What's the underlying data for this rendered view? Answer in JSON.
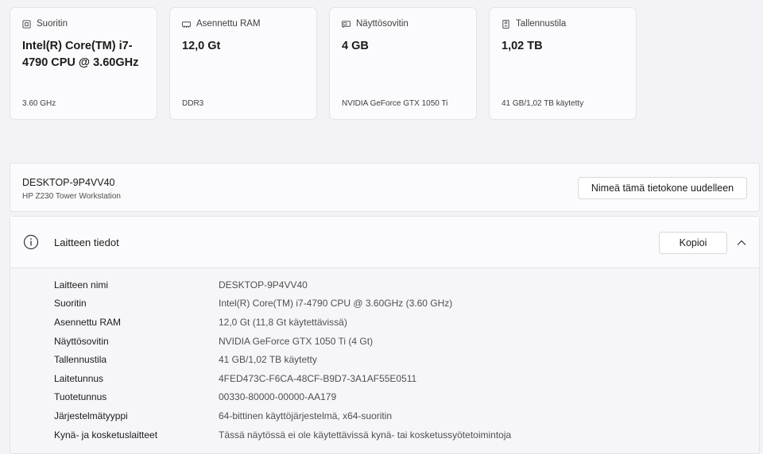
{
  "cards": [
    {
      "icon": "processor-icon",
      "title": "Suoritin",
      "value": "Intel(R) Core(TM) i7-4790 CPU @ 3.60GHz",
      "sub": "3.60 GHz"
    },
    {
      "icon": "ram-icon",
      "title": "Asennettu RAM",
      "value": "12,0 Gt",
      "sub": "DDR3"
    },
    {
      "icon": "gpu-icon",
      "title": "Näyttösovitin",
      "value": "4 GB",
      "sub": "NVIDIA GeForce GTX 1050 Ti"
    },
    {
      "icon": "storage-icon",
      "title": "Tallennustila",
      "value": "1,02 TB",
      "sub": "41 GB/1,02 TB käytetty"
    }
  ],
  "device": {
    "name": "DESKTOP-9P4VV40",
    "model": "HP Z230 Tower Workstation",
    "rename_label": "Nimeä tämä tietokone uudelleen"
  },
  "details": {
    "title": "Laitteen tiedot",
    "copy_label": "Kopioi",
    "rows": [
      {
        "k": "Laitteen nimi",
        "v": "DESKTOP-9P4VV40"
      },
      {
        "k": "Suoritin",
        "v": "Intel(R) Core(TM) i7-4790 CPU @ 3.60GHz (3.60 GHz)"
      },
      {
        "k": "Asennettu RAM",
        "v": "12,0 Gt (11,8 Gt käytettävissä)"
      },
      {
        "k": "Näyttösovitin",
        "v": "NVIDIA GeForce GTX 1050 Ti (4 Gt)"
      },
      {
        "k": "Tallennustila",
        "v": "41 GB/1,02 TB käytetty"
      },
      {
        "k": "Laitetunnus",
        "v": "4FED473C-F6CA-48CF-B9D7-3A1AF55E0511"
      },
      {
        "k": "Tuotetunnus",
        "v": "00330-80000-00000-AA179"
      },
      {
        "k": "Järjestelmätyyppi",
        "v": "64-bittinen käyttöjärjestelmä, x64-suoritin"
      },
      {
        "k": "Kynä- ja kosketuslaitteet",
        "v": "Tässä näytössä ei ole käytettävissä kynä- tai kosketussyötetoimintoja"
      }
    ]
  }
}
